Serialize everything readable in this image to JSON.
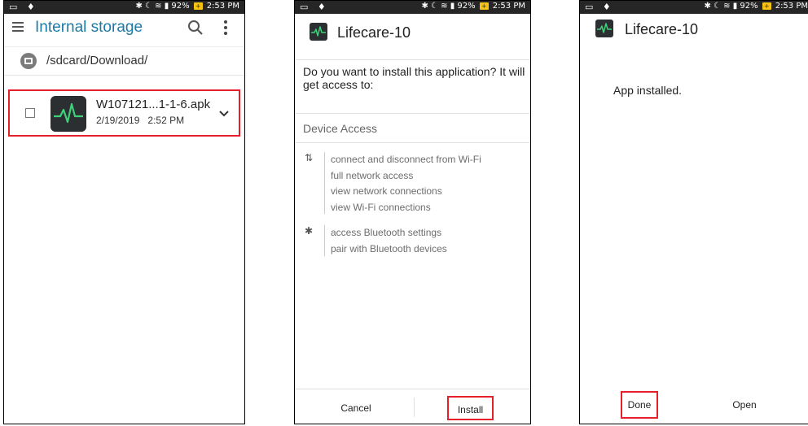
{
  "status_bar": {
    "left_glyphs": "▭ ♦",
    "right_text": "✱ ☾ ≋ ▮ 92%",
    "battery_badge": "+",
    "time": "2:53 PM"
  },
  "file_manager": {
    "title": "Internal storage",
    "path": "/sdcard/Download/",
    "file": {
      "name": "W107121...1-1-6.apk",
      "date": "2/19/2019",
      "time": "2:52 PM"
    }
  },
  "installer": {
    "app_name": "Lifecare-10",
    "question": "Do you want to install this application? It will get access to:",
    "section": "Device Access",
    "groups": [
      {
        "icon": "⇅",
        "items": [
          "connect and disconnect from Wi-Fi",
          "full network access",
          "view network connections",
          "view Wi-Fi connections"
        ]
      },
      {
        "icon": "✱",
        "items": [
          "access Bluetooth settings",
          "pair with Bluetooth devices"
        ]
      }
    ],
    "cancel_label": "Cancel",
    "install_label": "Install"
  },
  "installed_screen": {
    "app_name": "Lifecare-10",
    "message": "App installed.",
    "done_label": "Done",
    "open_label": "Open"
  },
  "colors": {
    "highlight": "#e5202a",
    "title_blue": "#1b7aa6",
    "status_bg": "#262626"
  }
}
